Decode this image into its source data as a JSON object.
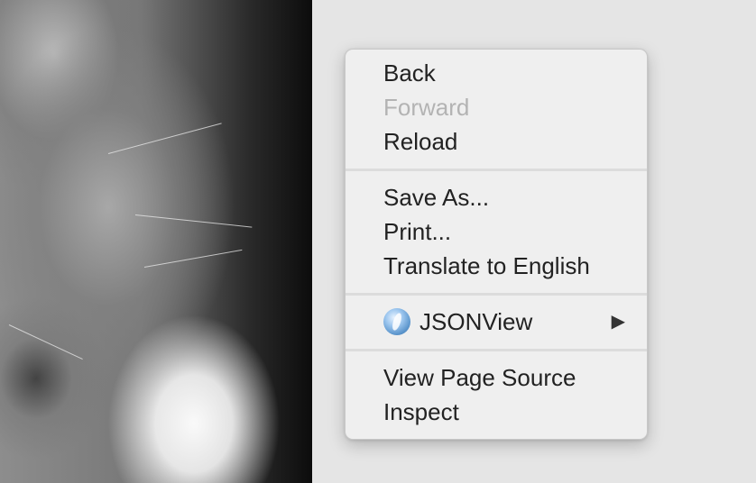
{
  "menu": {
    "items": {
      "back": {
        "label": "Back",
        "enabled": true
      },
      "forward": {
        "label": "Forward",
        "enabled": false
      },
      "reload": {
        "label": "Reload",
        "enabled": true
      },
      "save_as": {
        "label": "Save As...",
        "enabled": true
      },
      "print": {
        "label": "Print...",
        "enabled": true
      },
      "translate": {
        "label": "Translate to English",
        "enabled": true
      },
      "jsonview": {
        "label": "JSONView",
        "icon": "jsonview-extension-icon",
        "submenu_indicator": "▶",
        "enabled": true
      },
      "view_source": {
        "label": "View Page Source",
        "enabled": true
      },
      "inspect": {
        "label": "Inspect",
        "enabled": true
      }
    }
  },
  "background": {
    "left_image": "grayscale-cat-photo",
    "right_color": "#e5e5e5"
  }
}
